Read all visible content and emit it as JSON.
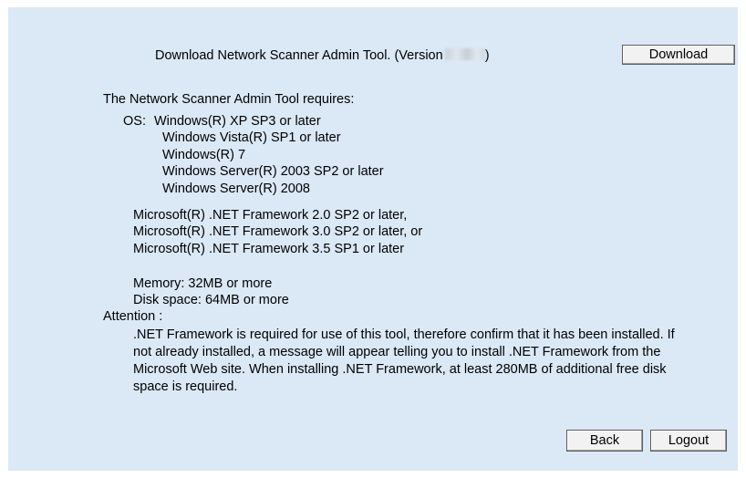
{
  "header": {
    "download_text": "Download Network Scanner Admin Tool. (Version",
    "download_text_close": ")",
    "download_button": "Download"
  },
  "requirements": {
    "intro": "The Network Scanner Admin Tool requires:",
    "os_label": "OS:",
    "os_items": [
      "Windows(R) XP SP3 or later",
      "Windows Vista(R) SP1 or later",
      "Windows(R) 7",
      "Windows Server(R) 2003 SP2 or later",
      "Windows Server(R) 2008"
    ],
    "framework_items": [
      "Microsoft(R) .NET Framework 2.0 SP2 or later,",
      "Microsoft(R) .NET Framework 3.0 SP2 or later, or",
      "Microsoft(R) .NET Framework 3.5 SP1 or later"
    ],
    "memory": "Memory: 32MB or more",
    "disk_space": "Disk space: 64MB or more"
  },
  "attention": {
    "label": "Attention :",
    "text": ".NET Framework is required for use of this tool, therefore confirm that it has been installed. If not already installed, a message will appear telling you to install .NET Framework from the Microsoft Web site. When installing .NET Framework, at least 280MB of additional free disk space is required."
  },
  "footer": {
    "back_button": "Back",
    "logout_button": "Logout"
  },
  "colors": {
    "panel_background": "#dbe8f6"
  }
}
